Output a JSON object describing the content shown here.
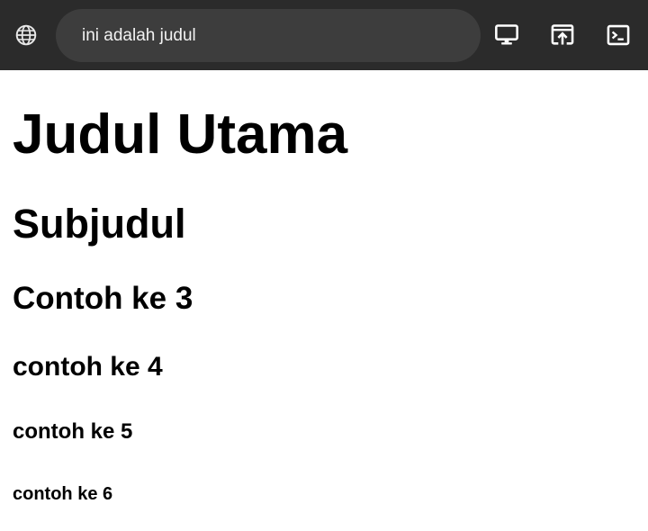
{
  "toolbar": {
    "address_text": "ini adalah judul",
    "icons": [
      "globe-icon",
      "desktop-icon",
      "open-in-new-icon",
      "terminal-icon"
    ]
  },
  "content": {
    "h1": "Judul Utama",
    "h2": "Subjudul",
    "h3": "Contoh ke 3",
    "h4": "contoh ke 4",
    "h5": "contoh ke 5",
    "h6": "contoh ke 6"
  },
  "colors": {
    "toolbar_bg": "#2b2b2b",
    "address_bg": "#3d3d3d",
    "page_bg": "#ffffff",
    "text": "#000000"
  }
}
